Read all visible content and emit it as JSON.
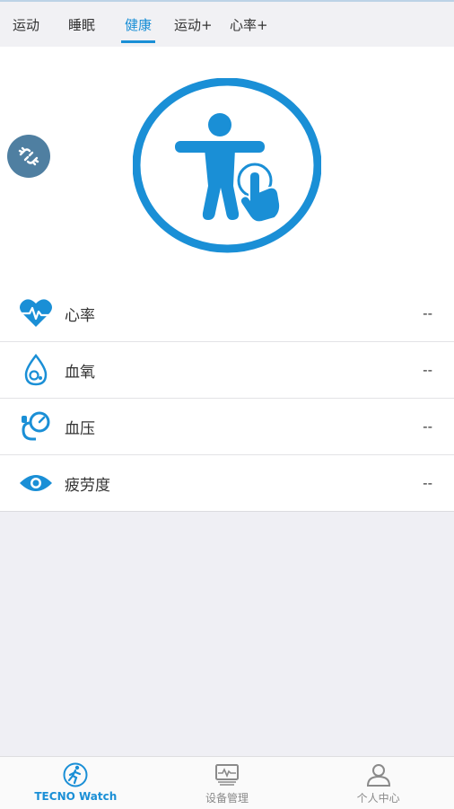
{
  "top_tabs": [
    {
      "label": "运动"
    },
    {
      "label": "睡眠"
    },
    {
      "label": "健康"
    },
    {
      "label": "运动+"
    },
    {
      "label": "心率+"
    }
  ],
  "active_tab": "健康",
  "hero": {
    "icon": "body-touch-icon",
    "link_icon": "unlink-icon"
  },
  "metrics": [
    {
      "label": "心率",
      "value": "--",
      "icon": "heart-pulse-icon"
    },
    {
      "label": "血氧",
      "value": "--",
      "icon": "blood-drop-icon"
    },
    {
      "label": "血压",
      "value": "--",
      "icon": "blood-pressure-icon"
    },
    {
      "label": "疲劳度",
      "value": "--",
      "icon": "eye-icon"
    }
  ],
  "bottom_nav": [
    {
      "label": "TECNO Watch",
      "icon": "runner-icon",
      "active": true
    },
    {
      "label": "设备管理",
      "icon": "device-monitor-icon",
      "active": false
    },
    {
      "label": "个人中心",
      "icon": "person-icon",
      "active": false
    }
  ],
  "colors": {
    "accent": "#1a8fd6",
    "link_button": "#4f7fa1",
    "background": "#efeff4"
  }
}
